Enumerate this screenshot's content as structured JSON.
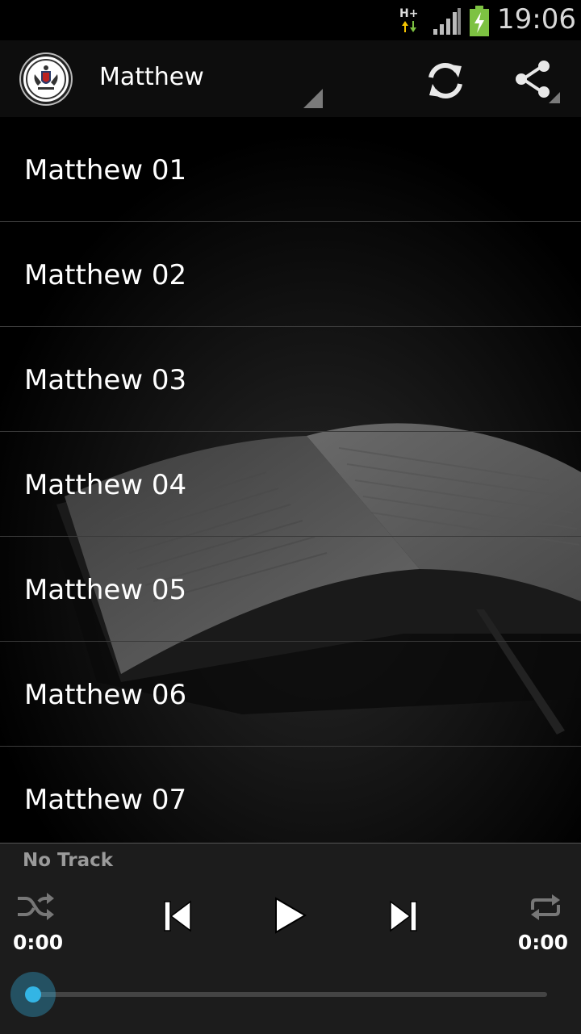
{
  "status_bar": {
    "time": "19:06",
    "network_type": "H+",
    "signal_icon": "cell-signal-icon",
    "battery_icon": "battery-charging-icon"
  },
  "action_bar": {
    "logo_icon": "crest-logo-icon",
    "title": "Matthew",
    "refresh_icon": "refresh-icon",
    "share_icon": "share-icon"
  },
  "list": {
    "items": [
      {
        "label": "Matthew 01"
      },
      {
        "label": "Matthew 02"
      },
      {
        "label": "Matthew 03"
      },
      {
        "label": "Matthew 04"
      },
      {
        "label": "Matthew 05"
      },
      {
        "label": "Matthew 06"
      },
      {
        "label": "Matthew 07"
      }
    ]
  },
  "player": {
    "track_name": "No Track",
    "elapsed": "0:00",
    "duration": "0:00",
    "progress_fraction": 0,
    "icons": [
      "shuffle-icon",
      "previous-icon",
      "play-icon",
      "next-icon",
      "repeat-icon"
    ],
    "accent_color": "#33b5e5"
  }
}
